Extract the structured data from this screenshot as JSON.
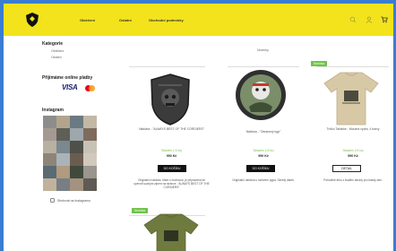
{
  "header": {
    "nav": [
      "Oblečení",
      "Ostatní",
      "Obchodní podmínky"
    ],
    "icons": [
      "search-icon",
      "user-icon",
      "cart-icon"
    ],
    "brand_color": "#f3e31c"
  },
  "sidebar": {
    "categories_title": "Kategorie",
    "categories": [
      "Oblečení",
      "Ostatní"
    ],
    "payments_title": "Přijímáme online platby",
    "payment_visa": "VISA",
    "instagram_title": "Instagram",
    "instagram_link": "Sledovat na Instagramu"
  },
  "main": {
    "sort_label": "Novinky",
    "products": [
      {
        "name": "Nášivka - \"ALWAYS BEST OF THE CORDIERS\"",
        "availability": "Skladem (>5 ks)",
        "price": "990 Kč",
        "button": "DO KOŠÍKU",
        "description": "Originální nášivka. Mám s možností, je připravená se upevnit suchým zipem na stránce. \"ALWAYS BEST OF THE CORDIERS\"",
        "badge": ""
      },
      {
        "name": "Nášivka - \"Obrácený tygr\"",
        "availability": "Skladem (>5 ks)",
        "price": "990 Kč",
        "button": "DO KOŠÍKU",
        "description": "Originální nášivka s motivem tygra. Skvělý dárek.",
        "badge": ""
      },
      {
        "name": "Tričko Taktické - Moudrá vydra, 4 barvy",
        "availability": "Skladem (>5 ks)",
        "price": "590 Kč",
        "button": "DETAIL",
        "description": "Pohodlné triko z kvalitní bavlny pro každý den.",
        "badge": "Novinka"
      },
      {
        "name": "",
        "availability": "",
        "price": "",
        "button": "",
        "description": "",
        "badge": "Novinka"
      }
    ]
  }
}
